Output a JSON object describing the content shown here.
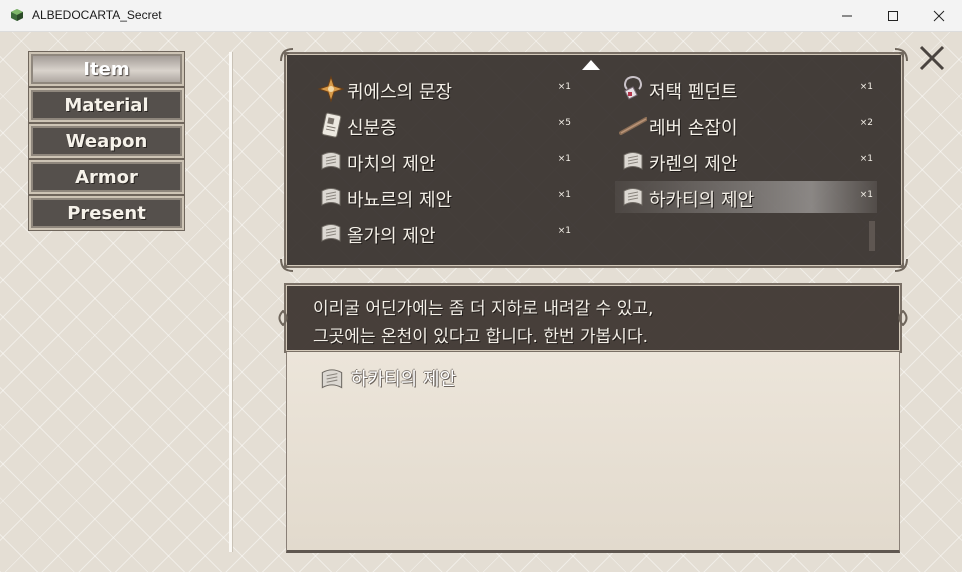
{
  "window": {
    "title": "ALBEDOCARTA_Secret",
    "icon": "app-icon"
  },
  "categories": [
    {
      "label": "Item",
      "selected": true
    },
    {
      "label": "Material",
      "selected": false
    },
    {
      "label": "Weapon",
      "selected": false
    },
    {
      "label": "Armor",
      "selected": false
    },
    {
      "label": "Present",
      "selected": false
    }
  ],
  "items": [
    {
      "name": "퀴에스의 문장",
      "qty": "×1",
      "icon": "emblem-icon"
    },
    {
      "name": "저택 펜던트",
      "qty": "×1",
      "icon": "pendant-icon"
    },
    {
      "name": "신분증",
      "qty": "×5",
      "icon": "id-card-icon"
    },
    {
      "name": "레버 손잡이",
      "qty": "×2",
      "icon": "lever-handle-icon"
    },
    {
      "name": "마치의 제안",
      "qty": "×1",
      "icon": "scroll-icon"
    },
    {
      "name": "카렌의 제안",
      "qty": "×1",
      "icon": "scroll-icon"
    },
    {
      "name": "바뇨르의 제안",
      "qty": "×1",
      "icon": "scroll-icon"
    },
    {
      "name": "하카티의 제안",
      "qty": "×1",
      "icon": "scroll-icon",
      "selected": true
    },
    {
      "name": "올가의 제안",
      "qty": "×1",
      "icon": "scroll-icon"
    }
  ],
  "description": {
    "line1": "이리굴 어딘가에는 좀 더 지하로 내려갈 수 있고,",
    "line2": "그곳에는 온천이 있다고 합니다. 한번 가봅시다."
  },
  "detail": {
    "name": "하카티의 제안",
    "icon": "scroll-icon"
  },
  "colors": {
    "panel_dark": "#37302d",
    "panel_light": "#e6dfd4",
    "background": "#e4ded4",
    "text_light": "#f4f0e8"
  }
}
